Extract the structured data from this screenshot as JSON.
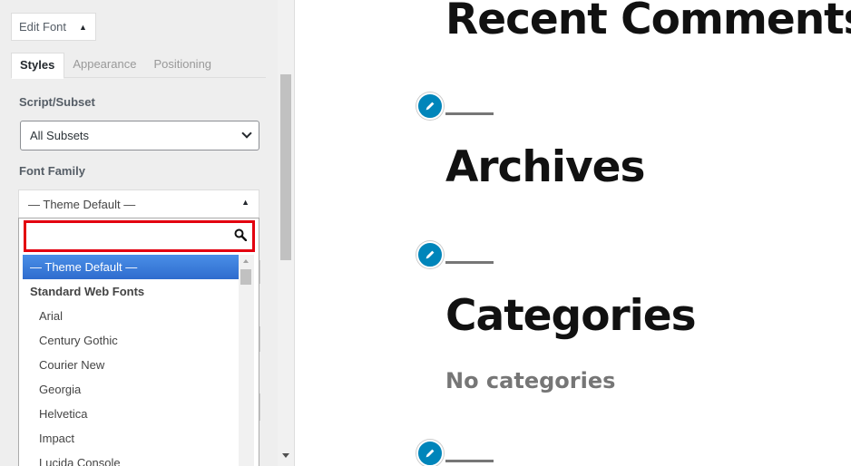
{
  "customizer": {
    "edit_font_label": "Edit Font",
    "tabs": [
      "Styles",
      "Appearance",
      "Positioning"
    ],
    "script_subset": {
      "label": "Script/Subset",
      "value": "All Subsets"
    },
    "font_family": {
      "label": "Font Family",
      "value": "— Theme Default —",
      "search_placeholder": "",
      "options": [
        {
          "label": "— Theme Default —",
          "kind": "selected"
        },
        {
          "label": "Standard Web Fonts",
          "kind": "group"
        },
        {
          "label": "Arial",
          "kind": "option"
        },
        {
          "label": "Century Gothic",
          "kind": "option"
        },
        {
          "label": "Courier New",
          "kind": "option"
        },
        {
          "label": "Georgia",
          "kind": "option"
        },
        {
          "label": "Helvetica",
          "kind": "option"
        },
        {
          "label": "Impact",
          "kind": "option"
        },
        {
          "label": "Lucida Console",
          "kind": "option"
        }
      ]
    }
  },
  "preview": {
    "widgets": [
      {
        "title": "Recent Comments"
      },
      {
        "title": "Archives"
      },
      {
        "title": "Categories",
        "content": "No categories"
      }
    ]
  },
  "colors": {
    "accent": "#3875d7",
    "highlight_border": "#e3000f",
    "edit_icon": "#0085ba"
  }
}
